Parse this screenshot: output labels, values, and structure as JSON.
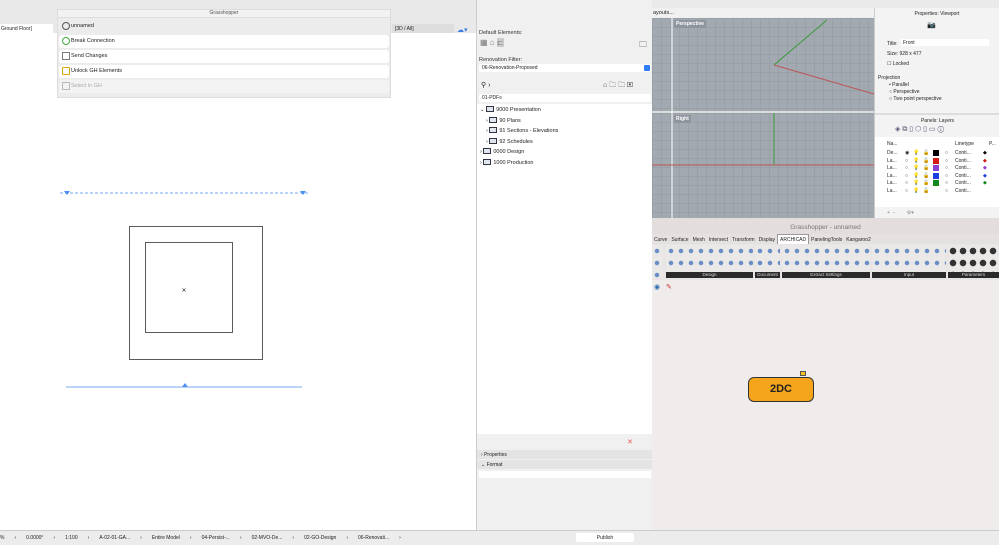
{
  "archicad": {
    "tab_left": "Ground Floor]",
    "tab_3d": "[3D / All]"
  },
  "gh_palette": {
    "title": "Grasshopper",
    "doc": "unnamed",
    "items": [
      "Break Connection",
      "Send Changes",
      "Unlock GH Elements",
      "Select in GH"
    ]
  },
  "navigator": {
    "default_elements": "Default Elements:",
    "renovation_label": "Renovation Filter:",
    "renovation_value": "06-Renovation-Proposed",
    "folder": "01-PDFs",
    "tree": [
      "9000 Presentation",
      "90 Plans",
      "91 Sections - Elevations",
      "92 Schedules",
      "0000 Design",
      "1000 Production"
    ],
    "properties": "Properties",
    "format": "Format"
  },
  "rhino": {
    "layouts": "ayouts...",
    "perspective": "Perspective",
    "right": "Right",
    "props_title": "Properties: Viewport",
    "title_label": "Title:",
    "title_value": "Front",
    "size_label": "Size:",
    "size_value": "928 x 477",
    "locked": "Locked",
    "projection": "Projection",
    "proj_options": [
      "Parallel",
      "Perspective",
      "Two point perspective"
    ],
    "layers_title": "Panels: Layers",
    "col_name": "Na...",
    "col_linetype": "Linetype",
    "col_p": "P...",
    "layers": [
      {
        "name": "De...",
        "color": "#000000",
        "lt": "Conti..."
      },
      {
        "name": "La...",
        "color": "#d21a1a",
        "lt": "Conti..."
      },
      {
        "name": "La...",
        "color": "#8a3fd6",
        "lt": "Conti..."
      },
      {
        "name": "La...",
        "color": "#1a3fe0",
        "lt": "Conti..."
      },
      {
        "name": "La...",
        "color": "#138a1e",
        "lt": "Conti..."
      },
      {
        "name": "La...",
        "color": "#ffffff",
        "lt": "Conti..."
      }
    ]
  },
  "grasshopper": {
    "title": "Grasshopper - unnamed",
    "tabs": [
      "Curve",
      "Surface",
      "Mesh",
      "Intersect",
      "Transform",
      "Display",
      "ARCHICAD",
      "PanelingTools",
      "Kangaroo2"
    ],
    "active_tab": "ARCHICAD",
    "groups": [
      "Design",
      "Document",
      "Extract Settings",
      "Input",
      "Parameters"
    ],
    "component": "2DC"
  },
  "status": {
    "items": [
      "%",
      "0.0000°",
      "1:100",
      "A-02-01-GA...",
      "Entire Model",
      "04-Persist-...",
      "02-MVO-De...",
      "02-GO-Design",
      "06-Renovati..."
    ],
    "publish": "Publish"
  }
}
